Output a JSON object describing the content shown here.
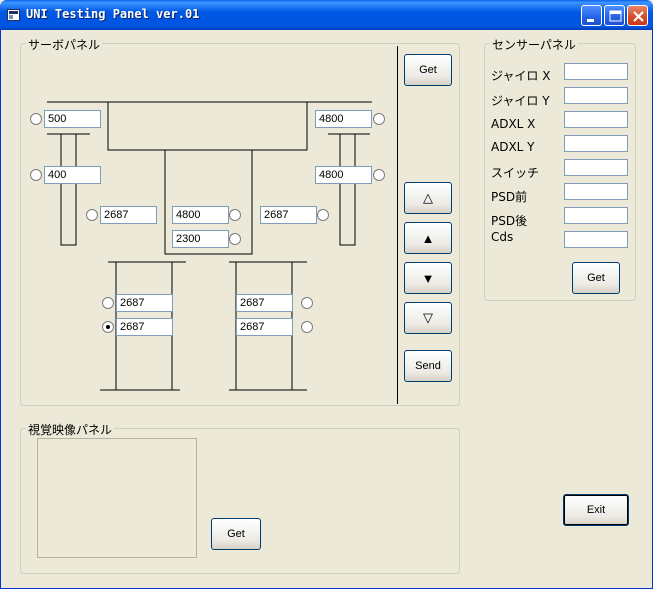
{
  "window": {
    "title": "UNI Testing Panel ver.01"
  },
  "servo_panel": {
    "label": "サーボパネル",
    "get_label": "Get",
    "send_label": "Send",
    "fields": {
      "left_top": "500",
      "right_top": "4800",
      "left_mid": "400",
      "right_mid": "4800",
      "hip_left": "2687",
      "center_top": "4800",
      "center_bottom": "2300",
      "hip_right": "2687",
      "leg_left_1": "2687",
      "leg_left_2": "2687",
      "leg_right_1": "2687",
      "leg_right_2": "2687"
    },
    "arrows": {
      "up_outline": "△",
      "up_filled": "▲",
      "down_filled": "▼",
      "down_outline": "▽"
    },
    "selected_radio": "leg-left-2"
  },
  "sensor_panel": {
    "label": "センサーパネル",
    "items": [
      "ジャイロ X",
      "ジャイロ Y",
      "ADXL X",
      "ADXL Y",
      "スイッチ",
      "PSD前",
      "PSD後",
      "Cds"
    ],
    "values": [
      "",
      "",
      "",
      "",
      "",
      "",
      "",
      ""
    ],
    "get_label": "Get"
  },
  "vision_panel": {
    "label": "視覚映像パネル",
    "get_label": "Get"
  },
  "exit_label": "Exit",
  "colors": {
    "title_bar": "#0058e6",
    "window_bg": "#ece9d8",
    "field_border": "#7f9db9"
  }
}
